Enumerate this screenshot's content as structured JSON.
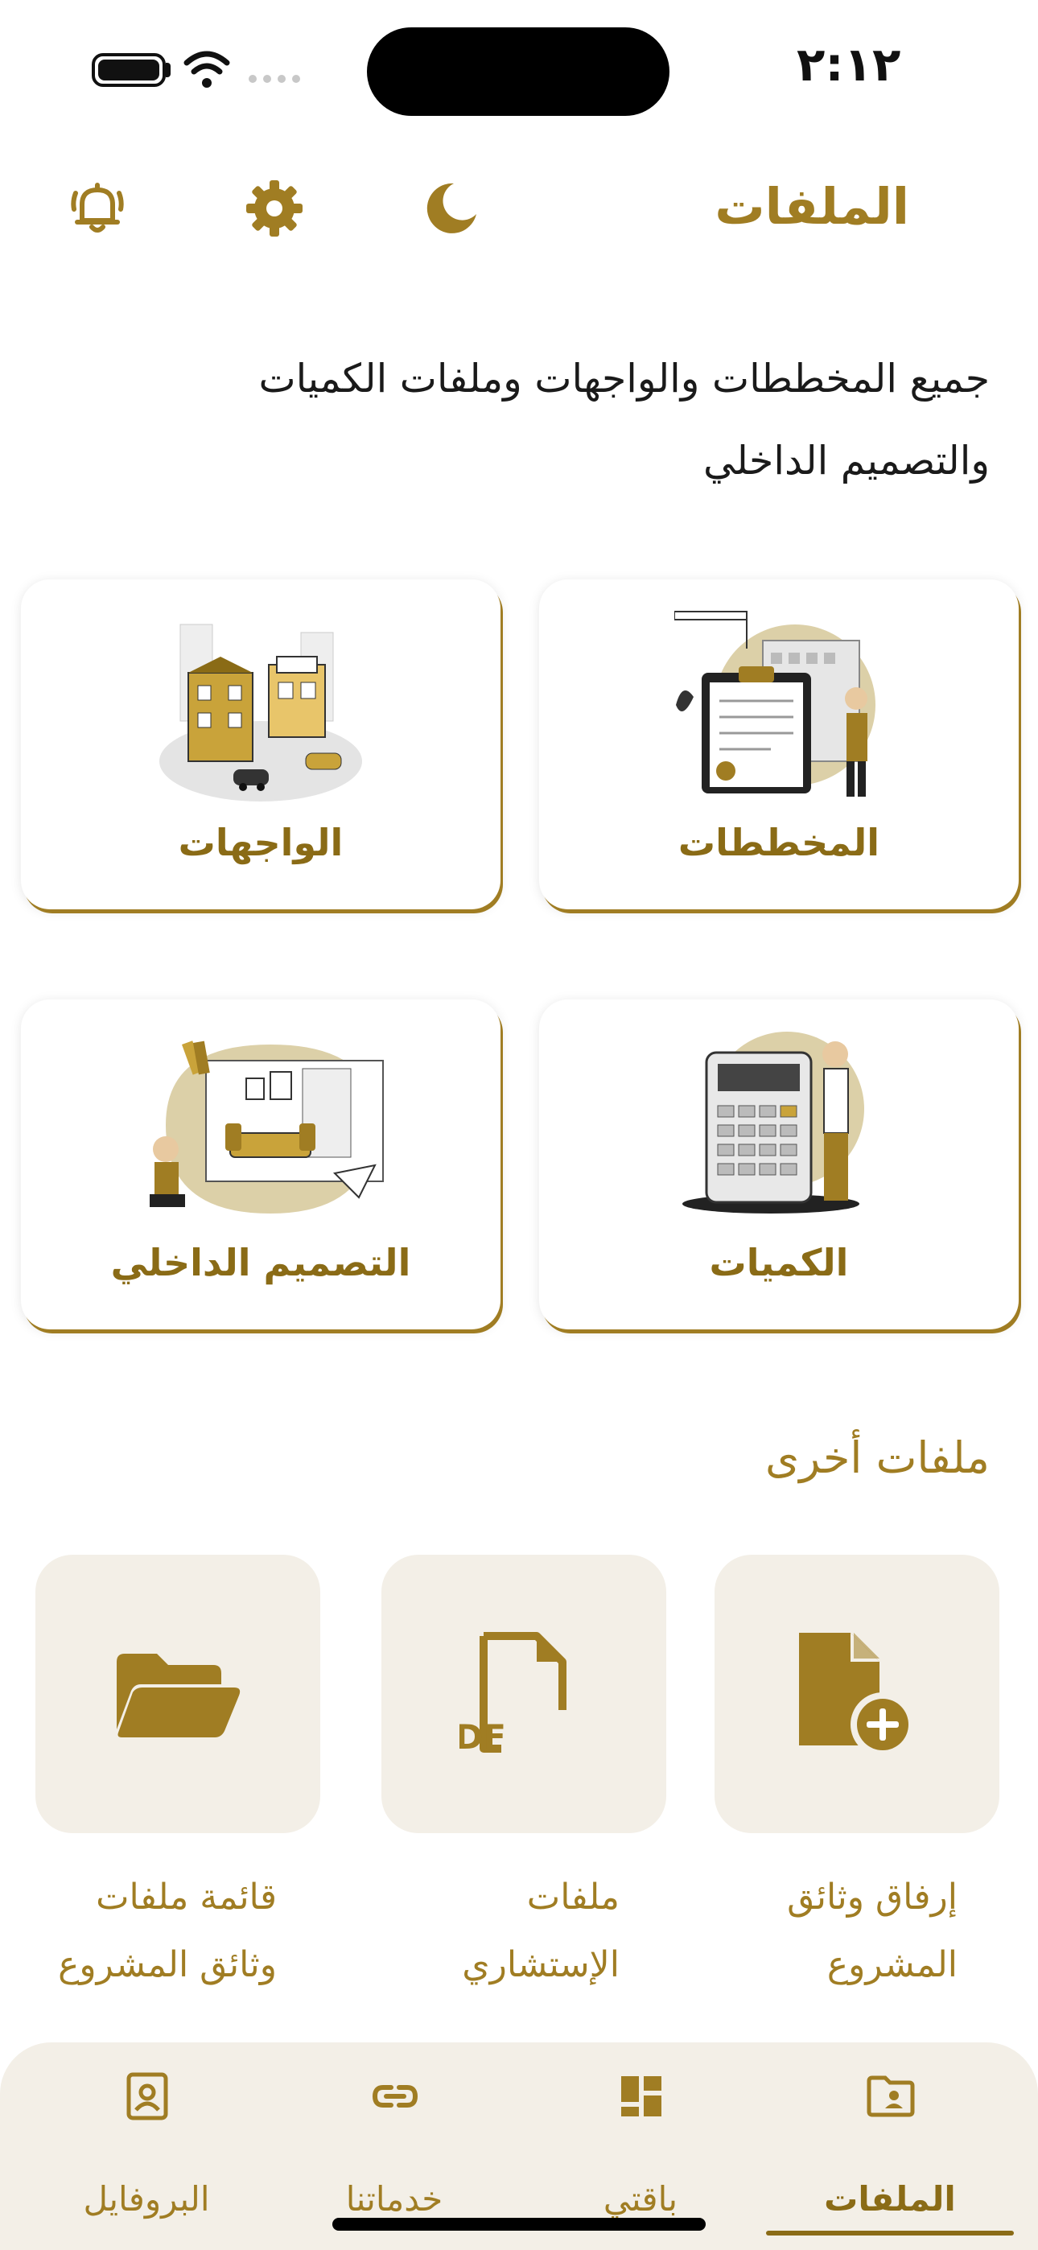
{
  "status_bar": {
    "time": "٢:١٢"
  },
  "header": {
    "title": "الملفات",
    "icons": [
      "moon-icon",
      "gear-icon",
      "bell-icon"
    ]
  },
  "intro": {
    "line1": "جميع المخططات والواجهات وملفات الكميات",
    "line2": "والتصميم الداخلي"
  },
  "categories": [
    {
      "label": "المخططات",
      "icon": "clipboard-plans-illustration"
    },
    {
      "label": "الواجهات",
      "icon": "buildings-facade-illustration"
    },
    {
      "label": "الكميات",
      "icon": "calculator-illustration"
    },
    {
      "label": "التصميم الداخلي",
      "icon": "interior-design-illustration"
    }
  ],
  "other_files": {
    "title": "ملفات أخرى",
    "items": [
      {
        "line1": "إرفاق وثائق",
        "line2": "المشروع",
        "icon": "file-add-icon"
      },
      {
        "line1": "ملفات",
        "line2": "الإستشاري",
        "icon": "pdf-file-icon"
      },
      {
        "line1": "قائمة ملفات",
        "line2": "وثائق المشروع",
        "icon": "folder-open-icon"
      }
    ]
  },
  "bottom_nav": {
    "items": [
      {
        "label": "الملفات",
        "icon": "folder-user-icon",
        "active": true
      },
      {
        "label": "باقتي",
        "icon": "dashboard-icon",
        "active": false
      },
      {
        "label": "خدماتنا",
        "icon": "link-icon",
        "active": false
      },
      {
        "label": "البروفايل",
        "icon": "profile-card-icon",
        "active": false
      }
    ]
  },
  "colors": {
    "accent": "#a07d23",
    "accent_dark": "#8a6b16",
    "tile_bg": "#f3efe7",
    "illustration_tan": "#dcd0a8"
  }
}
